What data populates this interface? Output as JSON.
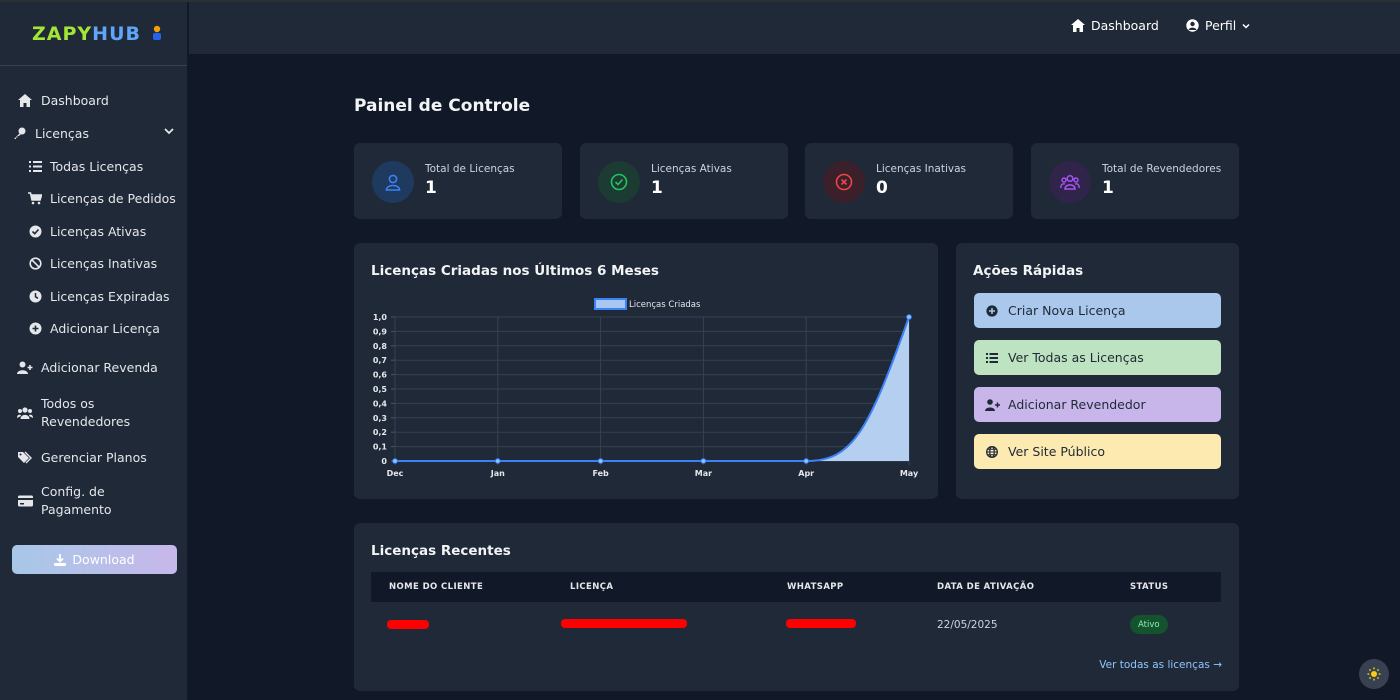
{
  "brand": {
    "part1": "ZAPY",
    "part2": "HUB"
  },
  "sidebar": {
    "items": [
      {
        "label": "Dashboard",
        "icon": "home-icon"
      },
      {
        "label": "Licenças",
        "icon": "key-icon",
        "expanded": true
      },
      {
        "label": "Todas Licenças",
        "icon": "list-icon"
      },
      {
        "label": "Licenças de Pedidos",
        "icon": "cart-icon"
      },
      {
        "label": "Licenças Ativas",
        "icon": "check-circle-icon"
      },
      {
        "label": "Licenças Inativas",
        "icon": "ban-icon"
      },
      {
        "label": "Licenças Expiradas",
        "icon": "clock-icon"
      },
      {
        "label": "Adicionar Licença",
        "icon": "plus-circle-icon"
      },
      {
        "label": "Adicionar Revenda",
        "icon": "user-plus-icon"
      },
      {
        "label": "Todos os",
        "label2": "Revendedores",
        "icon": "users-icon"
      },
      {
        "label": "Gerenciar Planos",
        "icon": "tags-icon"
      },
      {
        "label": "Config. de",
        "label2": "Pagamento",
        "icon": "credit-card-icon"
      }
    ],
    "download_label": "Download"
  },
  "topbar": {
    "dashboard_label": "Dashboard",
    "profile_label": "Perfil"
  },
  "page_title": "Painel de Controle",
  "stats": [
    {
      "label": "Total de Licenças",
      "value": "1",
      "color": "#3b82f6"
    },
    {
      "label": "Licenças Ativas",
      "value": "1",
      "color": "#22c55e"
    },
    {
      "label": "Licenças Inativas",
      "value": "0",
      "color": "#ef4444"
    },
    {
      "label": "Total de Revendedores",
      "value": "1",
      "color": "#a855f7"
    }
  ],
  "chart_card": {
    "title": "Licenças Criadas nos Últimos 6 Meses"
  },
  "chart_data": {
    "type": "area",
    "x": [
      "Dec",
      "Jan",
      "Feb",
      "Mar",
      "Apr",
      "May"
    ],
    "series": [
      {
        "name": "Licenças Criadas",
        "values": [
          0,
          0,
          0,
          0,
          0,
          1
        ]
      }
    ],
    "ylim": [
      0,
      1
    ],
    "yticks": [
      "1,0",
      "0,9",
      "0,8",
      "0,7",
      "0,6",
      "0,5",
      "0,4",
      "0,3",
      "0,2",
      "0,1",
      "0"
    ],
    "legend": "top-center",
    "grid": true,
    "line_color": "#3b82f6",
    "fill_color": "#b5cff0"
  },
  "quick_actions": {
    "title": "Ações Rápidas",
    "buttons": [
      {
        "label": "Criar Nova Licença",
        "icon": "plus-circle-icon",
        "color": "#a9c8ec"
      },
      {
        "label": "Ver Todas as Licenças",
        "icon": "list-icon",
        "color": "#bde3c1"
      },
      {
        "label": "Adicionar Revendedor",
        "icon": "user-plus-icon",
        "color": "#c8b6ea"
      },
      {
        "label": "Ver Site Público",
        "icon": "globe-icon",
        "color": "#fdeab0"
      }
    ]
  },
  "recent": {
    "title": "Licenças Recentes",
    "columns": [
      "NOME DO CLIENTE",
      "LICENÇA",
      "WHATSAPP",
      "DATA DE ATIVAÇÃO",
      "STATUS"
    ],
    "rows": [
      {
        "client": "",
        "license": "",
        "whatsapp": "",
        "date": "22/05/2025",
        "status": "Ativo"
      }
    ],
    "view_all": "Ver todas as licenças →"
  }
}
